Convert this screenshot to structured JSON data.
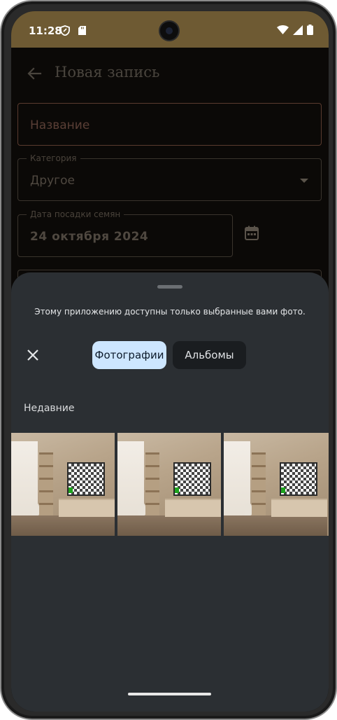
{
  "status_bar": {
    "time": "11:28",
    "background": "#6e5a33",
    "icons": [
      "vpn-shield-icon",
      "sd-card-icon",
      "wifi-icon",
      "signal-icon",
      "battery-icon"
    ]
  },
  "app_bar": {
    "title": "Новая запись",
    "back_icon": "arrow-back-icon"
  },
  "form": {
    "name_field": {
      "placeholder": "Название",
      "value": ""
    },
    "category_field": {
      "label": "Категория",
      "value": "Другое"
    },
    "date_field": {
      "label": "Дата посадки семян",
      "value": "24 октября 2024"
    }
  },
  "photo_picker": {
    "notice": "Этому приложению доступны только выбранные вами фото.",
    "tabs": [
      {
        "label": "Фотографии",
        "selected": true
      },
      {
        "label": "Альбомы",
        "selected": false
      }
    ],
    "section_title": "Недавние",
    "photos": [
      {
        "description": "room-with-tv"
      },
      {
        "description": "room-with-tv"
      },
      {
        "description": "room-with-tv"
      }
    ],
    "accent": "#cde6ff"
  }
}
